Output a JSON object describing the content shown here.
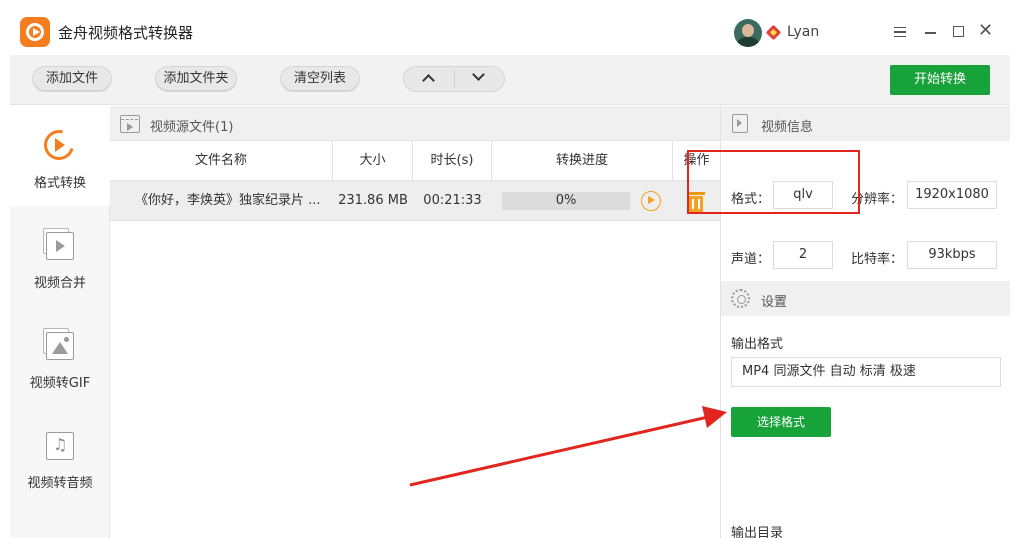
{
  "app": {
    "title": "金舟视频格式转换器",
    "user_name": "Lyan"
  },
  "toolbar": {
    "add_file": "添加文件",
    "add_folder": "添加文件夹",
    "clear_list": "清空列表",
    "start_convert": "开始转换"
  },
  "sidebar": {
    "items": [
      {
        "label": "格式转换",
        "icon": "format-convert-icon"
      },
      {
        "label": "视频合并",
        "icon": "video-merge-icon"
      },
      {
        "label": "视频转GIF",
        "icon": "image-icon"
      },
      {
        "label": "视频转音频",
        "icon": "music-icon"
      }
    ]
  },
  "file_panel": {
    "title": "视频源文件(1)",
    "columns": [
      "文件名称",
      "大小",
      "时长(s)",
      "转换进度",
      "操作"
    ],
    "rows": [
      {
        "name": "《你好，李焕英》独家纪录片 ...",
        "size": "231.86 MB",
        "duration": "00:21:33",
        "progress": "0%",
        "progress_value": 0
      }
    ]
  },
  "video_info": {
    "title": "视频信息",
    "format_label": "格式：",
    "format_value": "qlv",
    "resolution_label": "分辨率：",
    "resolution_value": "1920x1080",
    "channels_label": "声道：",
    "channels_value": "2",
    "bitrate_label": "比特率：",
    "bitrate_value": "93kbps"
  },
  "settings": {
    "title": "设置",
    "output_format_label": "输出格式",
    "output_format_value": "MP4 同源文件 自动 标清 极速",
    "select_format": "选择格式",
    "output_dir_label": "输出目录"
  },
  "colors": {
    "accent_green": "#17a23a",
    "brand_orange": "#f47d20",
    "annotation_red": "#e0261f"
  }
}
